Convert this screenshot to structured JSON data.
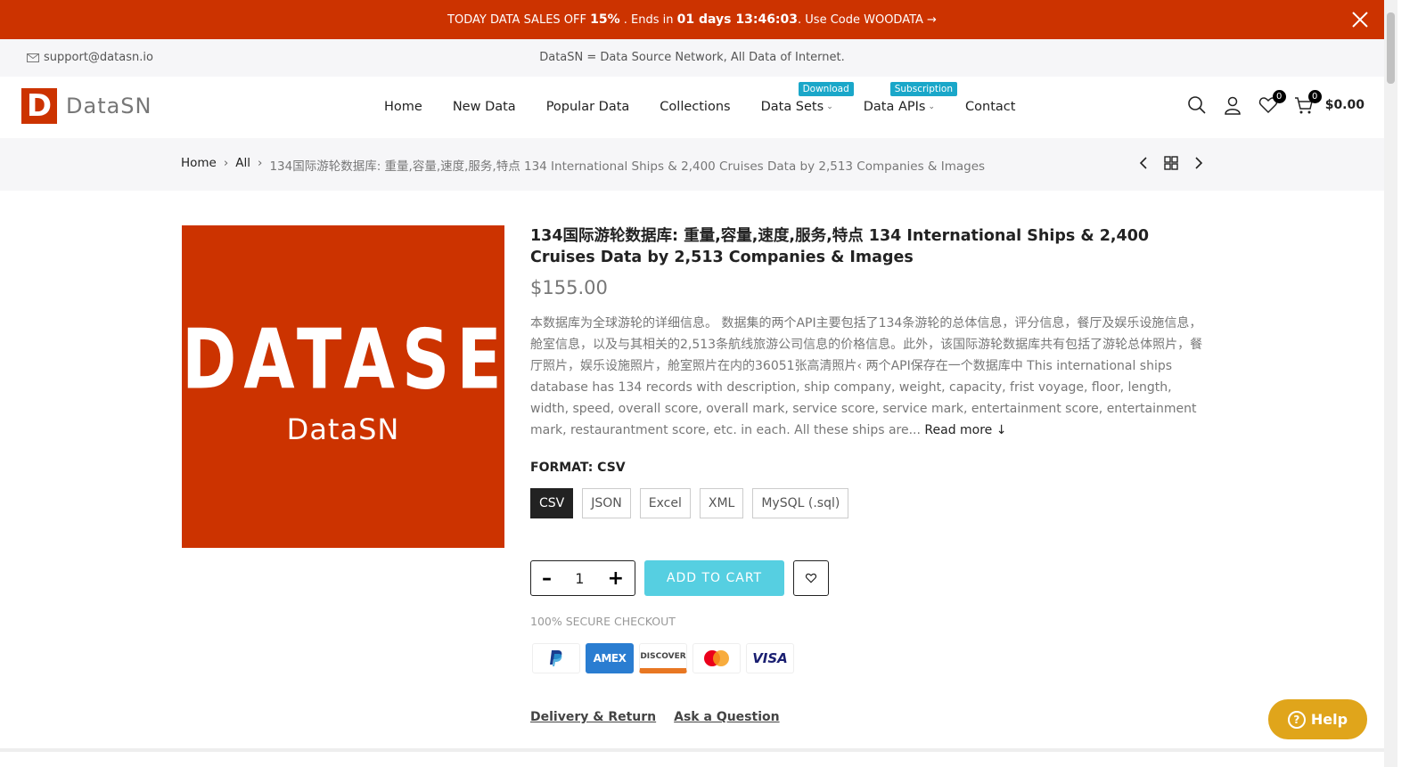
{
  "promo": {
    "prefix": "TODAY DATA SALES OFF ",
    "percent": "15%",
    "mid": " . Ends in ",
    "countdown": "01 days 13:46:03",
    "suffix": ". Use Code WOODATA →"
  },
  "topbar": {
    "email": "support@datasn.io",
    "tagline": "DataSN = Data Source Network, All Data of Internet."
  },
  "logo": {
    "letter": "D",
    "name": "DataSN"
  },
  "nav": {
    "home": "Home",
    "new_data": "New Data",
    "popular_data": "Popular Data",
    "collections": "Collections",
    "data_sets": "Data Sets",
    "data_sets_badge": "Download",
    "data_apis": "Data APIs",
    "data_apis_badge": "Subscription",
    "contact": "Contact"
  },
  "header_icons": {
    "wishlist_count": "0",
    "cart_count": "0",
    "cart_total": "$0.00"
  },
  "breadcrumb": {
    "home": "Home",
    "all": "All",
    "current": "134国际游轮数据库: 重量,容量,速度,服务,特点 134 International Ships & 2,400 Cruises Data by 2,513 Companies & Images"
  },
  "product": {
    "image_big": "DATASET",
    "image_small": "DataSN",
    "title": "134国际游轮数据库: 重量,容量,速度,服务,特点 134 International Ships & 2,400 Cruises Data by 2,513 Companies & Images",
    "price": "$155.00",
    "description": "本数据库为全球游轮的详细信息。 数据集的两个API主要包括了134条游轮的总体信息，评分信息，餐厅及娱乐设施信息，舱室信息，以及与其相关的2,513条航线旅游公司信息的价格信息。此外，该国际游轮数据库共有包括了游轮总体照片，餐厅照片，娱乐设施照片，舱室照片在内的36051张高清照片‹ 两个API保存在一个数据库中 This international ships database has 134 records with description, ship company, weight, capacity, frist voyage, floor, length, width, speed, overall score, overall mark, service score, service mark, entertainment score, entertainment mark, restaurantment score, etc. in each. All these ships are...",
    "read_more": "Read more ↓",
    "format_label": "FORMAT: CSV",
    "formats": [
      "CSV",
      "JSON",
      "Excel",
      "XML",
      "MySQL (.sql)"
    ],
    "quantity": "1",
    "add_to_cart": "ADD TO CART",
    "secure_checkout": "100% SECURE CHECKOUT",
    "payments": [
      "PayPal",
      "AMEX",
      "DISCOVER",
      "MasterCard",
      "VISA"
    ],
    "delivery_link": "Delivery & Return",
    "question_link": "Ask a Question"
  },
  "help": {
    "label": "Help"
  },
  "colors": {
    "brand": "#cc3300",
    "accent": "#56cfe1",
    "badge": "#1aa7c9",
    "help": "#e0a51b"
  }
}
